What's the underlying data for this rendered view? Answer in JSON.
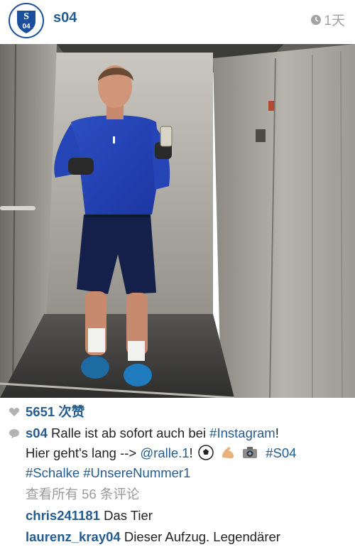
{
  "header": {
    "username": "s04",
    "time": "1天",
    "avatar_text": "04"
  },
  "post": {
    "likes_count": "5651",
    "likes_label": "次赞",
    "caption_user": "s04",
    "caption_line1": "Ralle ist ab sofort auch bei",
    "caption_hashtag1": "#Instagram",
    "caption_line1_end": "!",
    "caption_line2": "Hier geht's lang --> ",
    "caption_mention": "@ralle.1",
    "caption_line2_end": "! ",
    "caption_hashtag2": "#S04",
    "caption_hashtag3": "#Schalke",
    "caption_hashtag4": "#UnsereNummer1",
    "view_all_comments": "查看所有 56 条评论"
  },
  "comments": [
    {
      "user": "chris241181",
      "text": "Das Tier"
    },
    {
      "user": "laurenz_kray04",
      "text": "Dieser Aufzug. Legendärer"
    }
  ],
  "colors": {
    "link": "#245c90",
    "muted": "#9a9a9a",
    "brand": "#1b4f9c"
  },
  "icons": [
    "heart-icon",
    "comment-icon",
    "clock-icon",
    "soccer-ball-icon",
    "flexed-biceps-icon",
    "camera-icon"
  ]
}
